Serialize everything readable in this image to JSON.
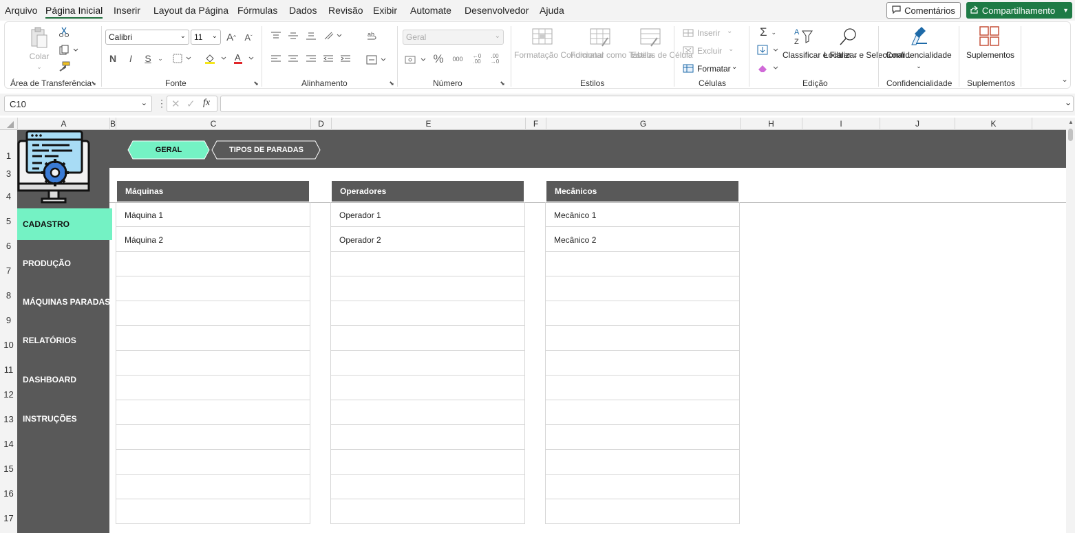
{
  "menu": {
    "items": [
      "Arquivo",
      "Página Inicial",
      "Inserir",
      "Layout da Página",
      "Fórmulas",
      "Dados",
      "Revisão",
      "Exibir",
      "Automate",
      "Desenvolvedor",
      "Ajuda"
    ],
    "comments": "Comentários",
    "share": "Compartilhamento"
  },
  "ribbon": {
    "clipboard": {
      "paste": "Colar",
      "label": "Área de Transferência"
    },
    "font": {
      "name": "Calibri",
      "size": "11",
      "bold": "N",
      "italic": "I",
      "underline": "S",
      "label": "Fonte"
    },
    "alignment": {
      "label": "Alinhamento"
    },
    "number": {
      "format": "Geral",
      "label": "Número"
    },
    "styles": {
      "cond_format": "Formatação Condicional",
      "format_table": "Formatar como Tabela",
      "cell_styles": "Estilos de Célula",
      "label": "Estilos"
    },
    "cells": {
      "insert": "Inserir",
      "delete": "Excluir",
      "format": "Formatar",
      "label": "Células"
    },
    "editing": {
      "sort": "Classificar e Filtrar",
      "find": "Localizar e Selecionar",
      "label": "Edição"
    },
    "sensitivity": {
      "button": "Confidencialidade",
      "label": "Confidencialidade"
    },
    "addins": {
      "button": "Suplementos",
      "label": "Suplementos"
    }
  },
  "formula_bar": {
    "name_box": "C10",
    "fx": "fx",
    "formula": ""
  },
  "columns": [
    "A",
    "B",
    "C",
    "D",
    "E",
    "F",
    "G",
    "H",
    "I",
    "J",
    "K"
  ],
  "rows": [
    "1",
    "3",
    "4",
    "5",
    "6",
    "7",
    "8",
    "9",
    "10",
    "11",
    "12",
    "13",
    "14",
    "15",
    "16",
    "17"
  ],
  "sheet": {
    "tabs": [
      {
        "label": "GERAL",
        "active": true
      },
      {
        "label": "TIPOS DE PARADAS",
        "active": false
      }
    ],
    "nav": [
      {
        "label": "CADASTRO",
        "active": true
      },
      {
        "label": "PRODUÇÃO"
      },
      {
        "label": "MÁQUINAS PARADAS"
      },
      {
        "label": "RELATÓRIOS"
      },
      {
        "label": "DASHBOARD"
      },
      {
        "label": "INSTRUÇÕES"
      }
    ],
    "tables": [
      {
        "header": "Máquinas",
        "items": [
          "Máquina 1",
          "Máquina 2",
          "",
          "",
          "",
          "",
          "",
          "",
          "",
          "",
          "",
          "",
          ""
        ]
      },
      {
        "header": "Operadores",
        "items": [
          "Operador 1",
          "Operador 2",
          "",
          "",
          "",
          "",
          "",
          "",
          "",
          "",
          "",
          "",
          ""
        ]
      },
      {
        "header": "Mecânicos",
        "items": [
          "Mecânico 1",
          "Mecânico 2",
          "",
          "",
          "",
          "",
          "",
          "",
          "",
          "",
          "",
          "",
          ""
        ]
      }
    ]
  },
  "colors": {
    "accent": "#74f2c4",
    "dark": "#595959",
    "excel_green": "#1e7a45"
  }
}
